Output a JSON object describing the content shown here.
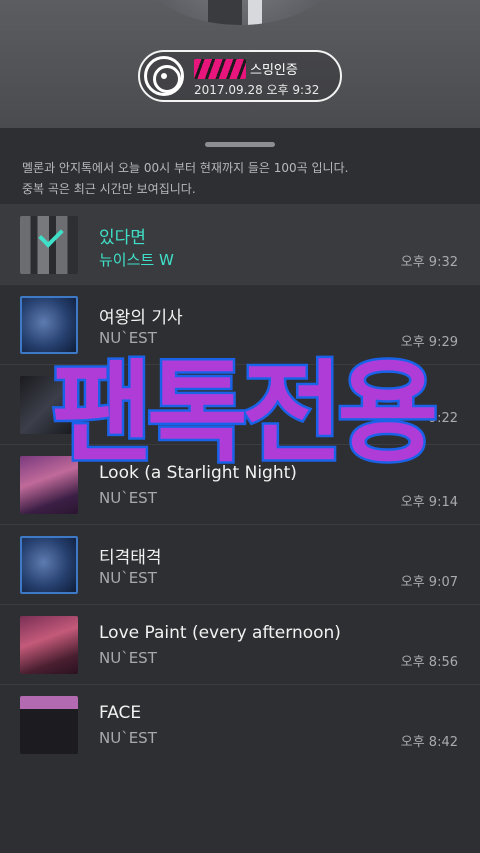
{
  "badge": {
    "icon": "vinyl-disc-icon",
    "certification_label": "스밍인증",
    "datetime": "2017.09.28 오후 9:32"
  },
  "info": {
    "line1": "멜론과 안지톡에서 오늘 00시 부터 현재까지 들은 100곡 입니다.",
    "line2": "중복 곡은 최근 시간만 보여집니다."
  },
  "tracks": [
    {
      "title": "있다면",
      "artist": "뉴이스트 W",
      "time": "오후 9:32",
      "current": true
    },
    {
      "title": "여왕의 기사",
      "artist": "NU`EST",
      "time": "오후 9:29"
    },
    {
      "title": "",
      "artist": "",
      "time": "9:22"
    },
    {
      "title": "Look (a Starlight Night)",
      "artist": "NU`EST",
      "time": "오후 9:14"
    },
    {
      "title": "티격태격",
      "artist": "NU`EST",
      "time": "오후 9:07"
    },
    {
      "title": "Love Paint (every afternoon)",
      "artist": "NU`EST",
      "time": "오후 8:56"
    },
    {
      "title": "FACE",
      "artist": "NU`EST",
      "time": "오후 8:42"
    }
  ],
  "colors": {
    "accent": "#3fe0c9",
    "watermark_fill": "#b03cd8",
    "watermark_stroke": "#1a63e8",
    "censor": "#e8157c"
  },
  "watermark": "팬톡전용"
}
